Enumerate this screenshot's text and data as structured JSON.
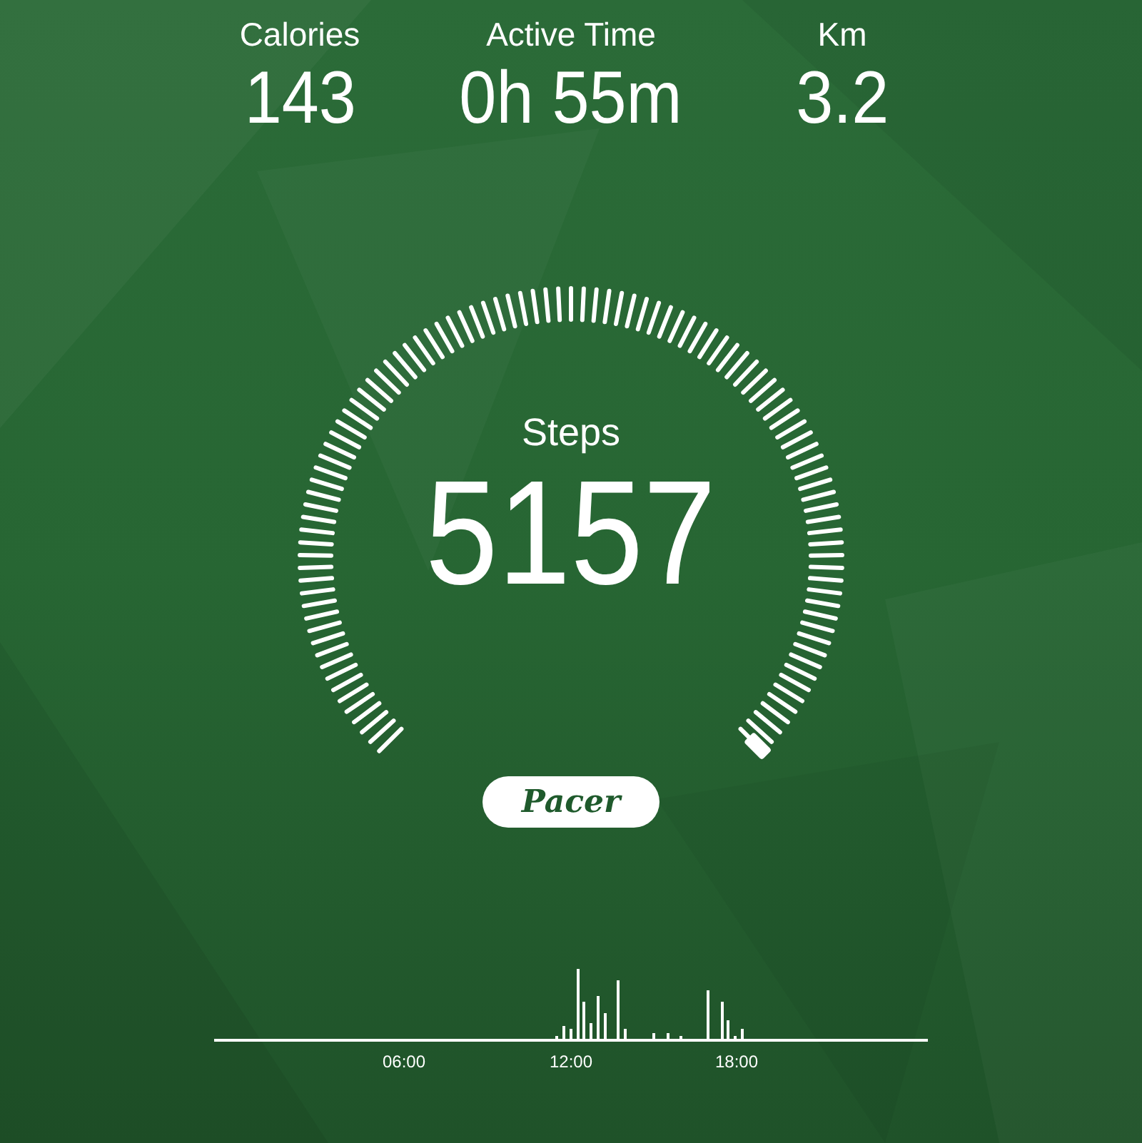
{
  "stats": [
    {
      "label": "Calories",
      "value": "143"
    },
    {
      "label": "Active Time",
      "value": "0h 55m"
    },
    {
      "label": "Km",
      "value": "3.2"
    }
  ],
  "gauge": {
    "label": "Steps",
    "value": "5157"
  },
  "badge": "Pacer",
  "activity_chart": {
    "time_labels": [
      "06:00",
      "12:00",
      "18:00"
    ]
  }
}
